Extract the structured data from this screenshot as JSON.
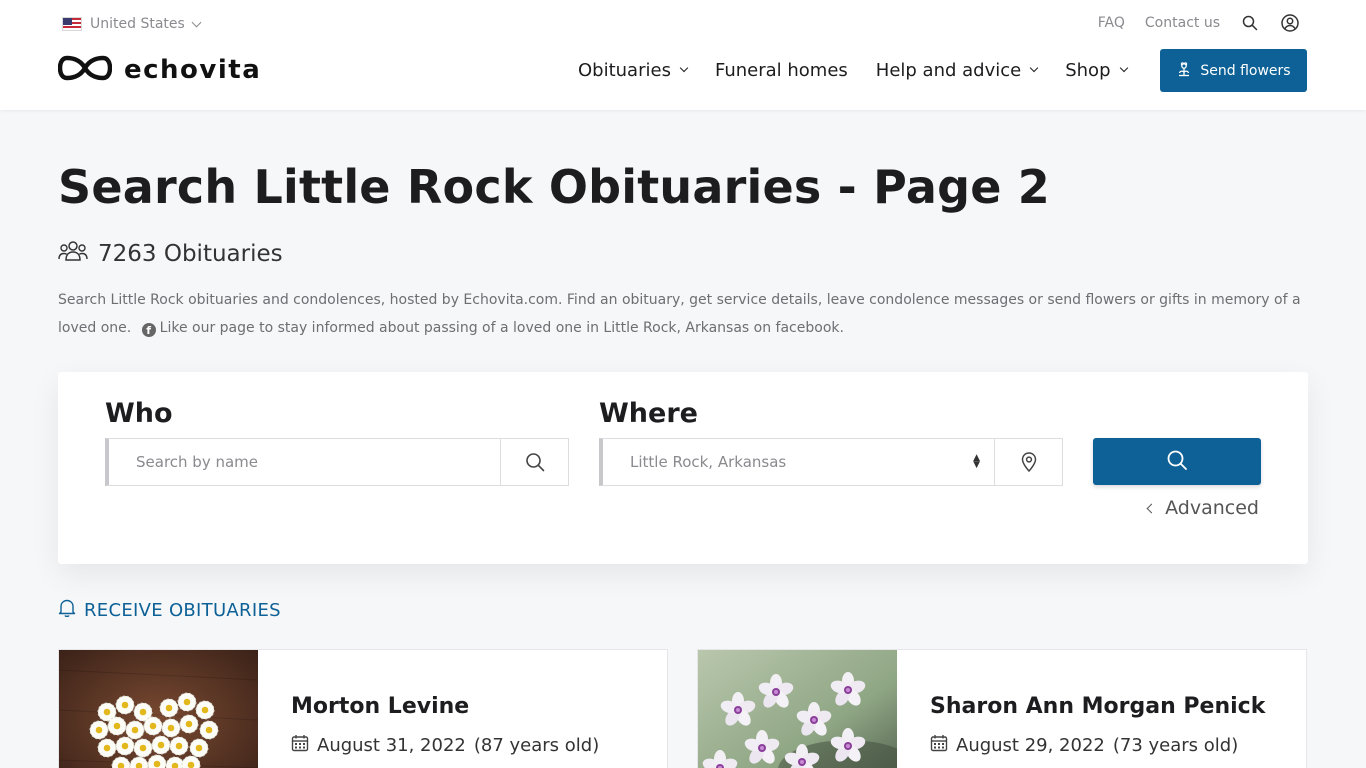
{
  "header": {
    "country": "United States",
    "top_links": {
      "faq": "FAQ",
      "contact": "Contact us"
    },
    "logo_text": "echovita",
    "nav": [
      {
        "label": "Obituaries",
        "has_dropdown": true
      },
      {
        "label": "Funeral homes",
        "has_dropdown": false
      },
      {
        "label": "Help and advice",
        "has_dropdown": true
      },
      {
        "label": "Shop",
        "has_dropdown": true
      }
    ],
    "send_flowers": "Send flowers"
  },
  "main": {
    "title": "Search Little Rock Obituaries - Page 2",
    "count_text": "7263 Obituaries",
    "description": "Search Little Rock obituaries and condolences, hosted by Echovita.com. Find an obituary, get service details, leave condolence messages or send flowers or gifts in memory of a loved one.",
    "facebook_text": "Like our page to stay informed about passing of a loved one in Little Rock, Arkansas on facebook."
  },
  "search": {
    "who_label": "Who",
    "who_placeholder": "Search by name",
    "where_label": "Where",
    "where_value": "Little Rock, Arkansas",
    "advanced": "Advanced"
  },
  "receive": "RECEIVE OBITUARIES",
  "obituaries": [
    {
      "name": "Morton Levine",
      "date": "August 31, 2022",
      "age": "(87 years old)"
    },
    {
      "name": "Sharon Ann Morgan Penick",
      "date": "August 29, 2022",
      "age": "(73 years old)"
    }
  ],
  "colors": {
    "accent": "#0d6196",
    "background": "#f6f7f9",
    "text": "#1d1d1f"
  },
  "icons": [
    "us-flag-icon",
    "search-icon",
    "user-icon",
    "infinity-logo-icon",
    "flower-icon",
    "people-icon",
    "facebook-icon",
    "map-pin-icon",
    "bell-icon",
    "calendar-icon"
  ]
}
